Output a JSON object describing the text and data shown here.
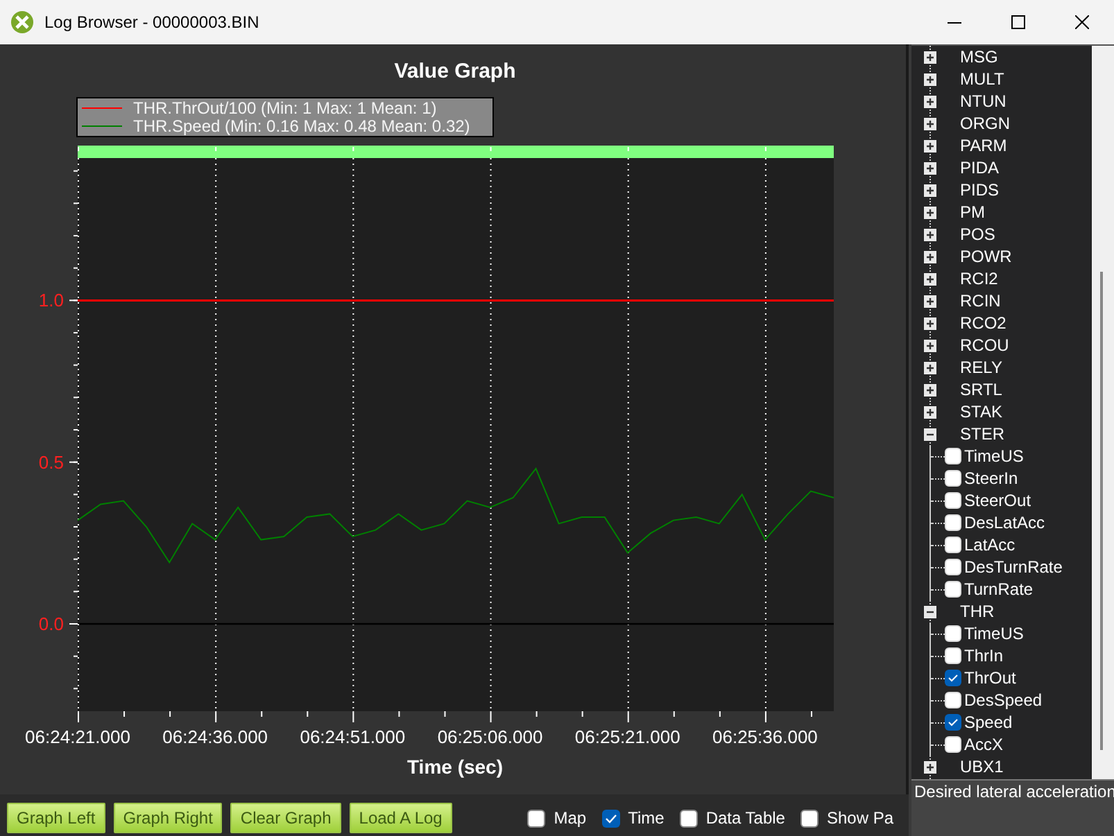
{
  "window": {
    "title": "Log Browser - 00000003.BIN"
  },
  "graph": {
    "legend_stats": [
      "(Min: 1 Max: 1 Mean: 1)",
      "(Min: 0.16 Max: 0.48 Mean: 0.32)"
    ],
    "chart_data": {
      "type": "line",
      "title": "Value Graph",
      "xlabel": "Time (sec)",
      "categories": [
        "06:24:21.000",
        null,
        null,
        null,
        null,
        null,
        "06:24:36.000",
        null,
        null,
        null,
        null,
        null,
        "06:24:51.000",
        null,
        null,
        null,
        null,
        null,
        "06:25:06.000",
        null,
        null,
        null,
        null,
        null,
        "06:25:21.000",
        null,
        null,
        null,
        null,
        null,
        "06:25:36.000",
        null,
        null,
        null
      ],
      "series": [
        {
          "name": "THR.ThrOut/100",
          "color": "#ff0000",
          "values": [
            1,
            1,
            1,
            1,
            1,
            1,
            1,
            1,
            1,
            1,
            1,
            1,
            1,
            1,
            1,
            1,
            1,
            1,
            1,
            1,
            1,
            1,
            1,
            1,
            1,
            1,
            1,
            1,
            1,
            1,
            1,
            1,
            1,
            1
          ]
        },
        {
          "name": "THR.Speed",
          "color": "#008000",
          "values": [
            0.32,
            0.37,
            0.38,
            0.3,
            0.19,
            0.31,
            0.26,
            0.36,
            0.26,
            0.27,
            0.33,
            0.34,
            0.27,
            0.29,
            0.34,
            0.29,
            0.31,
            0.38,
            0.36,
            0.39,
            0.48,
            0.31,
            0.33,
            0.33,
            0.22,
            0.28,
            0.32,
            0.33,
            0.31,
            0.4,
            0.26,
            0.34,
            0.41,
            0.39
          ]
        }
      ],
      "grid": true,
      "ylim": [
        -0.27,
        1.44
      ],
      "yticks": [
        {
          "value": 0,
          "label": "0.0"
        },
        {
          "value": 0.5,
          "label": "0.5"
        },
        {
          "value": 1,
          "label": "1.0"
        }
      ]
    }
  },
  "tree": {
    "items": [
      {
        "label": "MSG",
        "expanded": false
      },
      {
        "label": "MULT",
        "expanded": false
      },
      {
        "label": "NTUN",
        "expanded": false
      },
      {
        "label": "ORGN",
        "expanded": false
      },
      {
        "label": "PARM",
        "expanded": false
      },
      {
        "label": "PIDA",
        "expanded": false
      },
      {
        "label": "PIDS",
        "expanded": false
      },
      {
        "label": "PM",
        "expanded": false
      },
      {
        "label": "POS",
        "expanded": false
      },
      {
        "label": "POWR",
        "expanded": false
      },
      {
        "label": "RCI2",
        "expanded": false
      },
      {
        "label": "RCIN",
        "expanded": false
      },
      {
        "label": "RCO2",
        "expanded": false
      },
      {
        "label": "RCOU",
        "expanded": false
      },
      {
        "label": "RELY",
        "expanded": false
      },
      {
        "label": "SRTL",
        "expanded": false
      },
      {
        "label": "STAK",
        "expanded": false
      },
      {
        "label": "STER",
        "expanded": true,
        "children": [
          {
            "label": "TimeUS",
            "checked": false
          },
          {
            "label": "SteerIn",
            "checked": false
          },
          {
            "label": "SteerOut",
            "checked": false
          },
          {
            "label": "DesLatAcc",
            "checked": false
          },
          {
            "label": "LatAcc",
            "checked": false
          },
          {
            "label": "DesTurnRate",
            "checked": false
          },
          {
            "label": "TurnRate",
            "checked": false
          }
        ]
      },
      {
        "label": "THR",
        "expanded": true,
        "children": [
          {
            "label": "TimeUS",
            "checked": false
          },
          {
            "label": "ThrIn",
            "checked": false
          },
          {
            "label": "ThrOut",
            "checked": true
          },
          {
            "label": "DesSpeed",
            "checked": false
          },
          {
            "label": "Speed",
            "checked": true
          },
          {
            "label": "AccX",
            "checked": false
          }
        ]
      },
      {
        "label": "UBX1",
        "expanded": false
      }
    ]
  },
  "description": "Desired lateral acceleration",
  "buttons": [
    "Graph Left",
    "Graph Right",
    "Clear Graph",
    "Load A Log"
  ],
  "options": [
    {
      "label": "Map",
      "checked": false
    },
    {
      "label": "Time",
      "checked": true
    },
    {
      "label": "Data Table",
      "checked": false
    },
    {
      "label": "Show Pa",
      "checked": false
    }
  ]
}
